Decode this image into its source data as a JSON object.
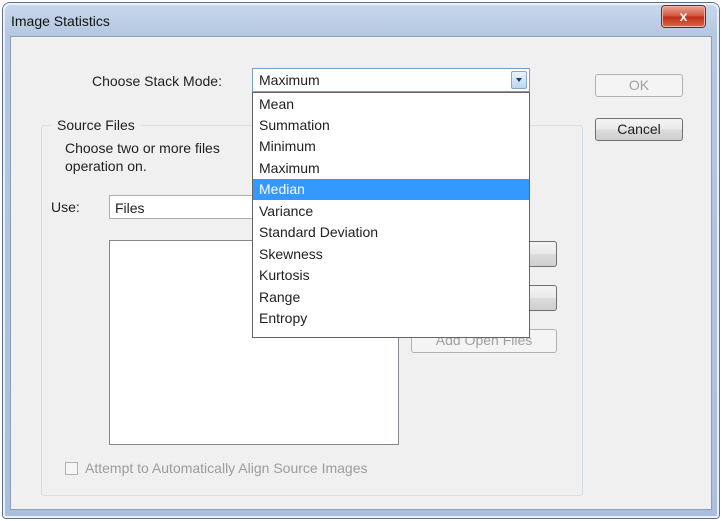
{
  "window": {
    "title": "Image Statistics",
    "close_glyph": "x"
  },
  "stack_mode": {
    "label": "Choose Stack Mode:",
    "value": "Maximum",
    "options": [
      "Mean",
      "Summation",
      "Minimum",
      "Maximum",
      "Median",
      "Variance",
      "Standard Deviation",
      "Skewness",
      "Kurtosis",
      "Range",
      "Entropy"
    ],
    "highlighted": "Median"
  },
  "buttons": {
    "ok": "OK",
    "cancel": "Cancel",
    "add_open_files": "Add Open Files"
  },
  "source_files": {
    "legend": "Source Files",
    "description_line1": "Choose two or more files",
    "description_line2": "operation on.",
    "use_label": "Use:",
    "use_value": "Files"
  },
  "align_checkbox": {
    "label": "Attempt to Automatically Align Source Images",
    "checked": false
  },
  "colors": {
    "selection": "#3399ff",
    "dialog_bg": "#f0f0f0"
  }
}
